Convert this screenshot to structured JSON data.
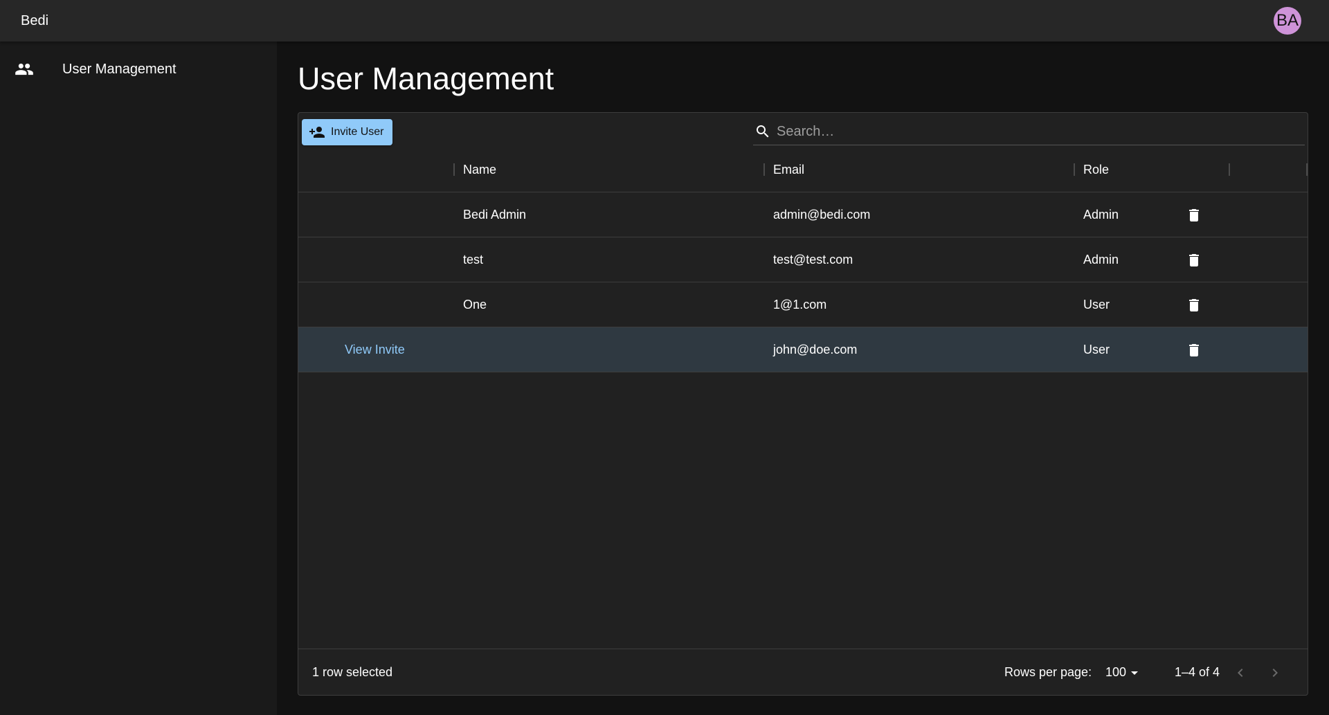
{
  "app": {
    "title": "Bedi",
    "avatar_initials": "BA",
    "avatar_color": "#ce93d8"
  },
  "sidebar": {
    "items": [
      {
        "label": "User Management",
        "icon": "people-icon"
      }
    ]
  },
  "main": {
    "page_title": "User Management"
  },
  "grid": {
    "toolbar": {
      "invite_label": "Invite User",
      "search_placeholder": "Search…"
    },
    "columns": [
      "Name",
      "Email",
      "Role"
    ],
    "rows": [
      {
        "name": "Bedi Admin",
        "email": "admin@bedi.com",
        "role": "Admin"
      },
      {
        "name": "test",
        "email": "test@test.com",
        "role": "Admin"
      },
      {
        "name": "One",
        "email": "1@1.com",
        "role": "User"
      },
      {
        "action": "View Invite",
        "email": "john@doe.com",
        "role": "User",
        "selected": true
      }
    ],
    "footer": {
      "selected_text": "1 row selected",
      "rows_per_page_label": "Rows per page:",
      "rows_per_page_value": "100",
      "range_text": "1–4 of 4"
    }
  },
  "colors": {
    "accent": "#90caf9",
    "selected_row": "#2f3941"
  }
}
